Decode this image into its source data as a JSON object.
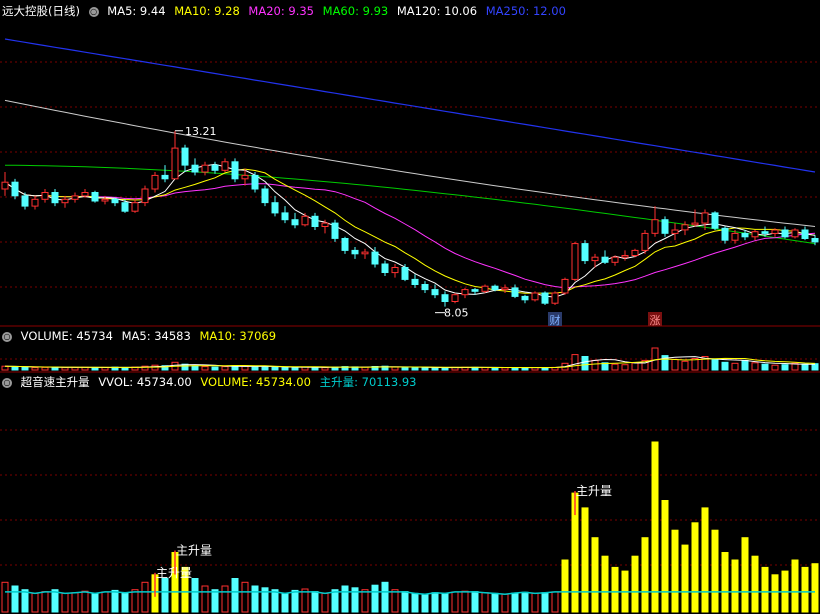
{
  "main": {
    "title": "远大控股(日线)",
    "ma_legend": [
      {
        "label": "MA5: 9.44",
        "color": "#ffffff"
      },
      {
        "label": "MA10: 9.28",
        "color": "#ffff00"
      },
      {
        "label": "MA20: 9.35",
        "color": "#ff00ff"
      },
      {
        "label": "MA60: 9.93",
        "color": "#00ff00"
      },
      {
        "label": "MA120: 10.06",
        "color": "#ffffff"
      },
      {
        "label": "MA250: 12.00",
        "color": "#3344ff"
      }
    ]
  },
  "volume_panel": {
    "legend": [
      {
        "label": "VOLUME: 45734",
        "color": "#ffffff"
      },
      {
        "label": "MA5: 34583",
        "color": "#ffffff"
      },
      {
        "label": "MA10: 37069",
        "color": "#ffff00"
      }
    ]
  },
  "indicator_panel": {
    "legend": [
      {
        "label": "超音速主升量",
        "color": "#ffffff"
      },
      {
        "label": "VVOL: 45734.00",
        "color": "#ffffff"
      },
      {
        "label": "VOLUME: 45734.00",
        "color": "#ffff00"
      },
      {
        "label": "主升量: 70113.93",
        "color": "#00cccc"
      }
    ]
  },
  "colors": {
    "up": "#ff3030",
    "down": "#54ffff",
    "ma5": "#ffffff",
    "ma10": "#ffff00",
    "ma20": "#ff33ff",
    "ma60": "#00cc00",
    "ma120": "#cccccc",
    "ma250": "#2233ee",
    "grid": "#7a0000",
    "separator": "#8b0000",
    "signal": "#ffff00"
  },
  "chart_data": [
    {
      "type": "candlestick",
      "title": "远大控股(日线)",
      "annotations": [
        {
          "text": "13.21",
          "kind": "high"
        },
        {
          "text": "8.05",
          "kind": "low"
        },
        {
          "text": "财",
          "kind": "event"
        },
        {
          "text": "涨",
          "kind": "event"
        }
      ],
      "candles": [
        [
          11.5,
          12.0,
          11.3,
          11.7
        ],
        [
          11.7,
          11.8,
          11.2,
          11.3
        ],
        [
          11.3,
          11.4,
          10.9,
          11.0
        ],
        [
          11.0,
          11.3,
          10.9,
          11.2
        ],
        [
          11.2,
          11.5,
          11.1,
          11.4
        ],
        [
          11.4,
          11.5,
          11.0,
          11.1
        ],
        [
          11.1,
          11.3,
          10.95,
          11.2
        ],
        [
          11.2,
          11.4,
          11.1,
          11.3
        ],
        [
          11.3,
          11.5,
          11.25,
          11.4
        ],
        [
          11.4,
          11.45,
          11.1,
          11.15
        ],
        [
          11.15,
          11.3,
          11.05,
          11.2
        ],
        [
          11.2,
          11.25,
          11.0,
          11.1
        ],
        [
          11.1,
          11.2,
          10.8,
          10.85
        ],
        [
          10.85,
          11.2,
          10.8,
          11.1
        ],
        [
          11.1,
          11.6,
          11.0,
          11.5
        ],
        [
          11.5,
          12.0,
          11.4,
          11.9
        ],
        [
          11.9,
          12.2,
          11.7,
          11.8
        ],
        [
          11.8,
          13.21,
          11.8,
          12.7
        ],
        [
          12.7,
          12.8,
          12.0,
          12.2
        ],
        [
          12.2,
          12.4,
          11.9,
          12.0
        ],
        [
          12.0,
          12.3,
          11.9,
          12.2
        ],
        [
          12.2,
          12.3,
          11.95,
          12.05
        ],
        [
          12.05,
          12.4,
          12.0,
          12.3
        ],
        [
          12.3,
          12.4,
          11.7,
          11.8
        ],
        [
          11.8,
          12.1,
          11.6,
          11.9
        ],
        [
          11.9,
          12.0,
          11.4,
          11.5
        ],
        [
          11.5,
          11.6,
          11.0,
          11.1
        ],
        [
          11.1,
          11.3,
          10.7,
          10.8
        ],
        [
          10.8,
          11.0,
          10.5,
          10.6
        ],
        [
          10.6,
          10.8,
          10.35,
          10.45
        ],
        [
          10.45,
          10.8,
          10.4,
          10.7
        ],
        [
          10.7,
          10.8,
          10.3,
          10.4
        ],
        [
          10.4,
          10.6,
          10.2,
          10.5
        ],
        [
          10.5,
          10.6,
          9.95,
          10.05
        ],
        [
          10.05,
          10.1,
          9.6,
          9.7
        ],
        [
          9.7,
          9.8,
          9.45,
          9.6
        ],
        [
          9.6,
          9.75,
          9.45,
          9.65
        ],
        [
          9.65,
          9.8,
          9.2,
          9.3
        ],
        [
          9.3,
          9.4,
          8.95,
          9.05
        ],
        [
          9.05,
          9.3,
          8.9,
          9.2
        ],
        [
          9.2,
          9.3,
          8.8,
          8.85
        ],
        [
          8.85,
          9.0,
          8.6,
          8.7
        ],
        [
          8.7,
          8.8,
          8.45,
          8.55
        ],
        [
          8.55,
          8.7,
          8.3,
          8.4
        ],
        [
          8.4,
          8.5,
          8.05,
          8.2
        ],
        [
          8.2,
          8.45,
          8.15,
          8.4
        ],
        [
          8.4,
          8.6,
          8.3,
          8.55
        ],
        [
          8.55,
          8.6,
          8.4,
          8.5
        ],
        [
          8.5,
          8.7,
          8.45,
          8.65
        ],
        [
          8.65,
          8.7,
          8.5,
          8.55
        ],
        [
          8.55,
          8.7,
          8.45,
          8.6
        ],
        [
          8.6,
          8.7,
          8.3,
          8.35
        ],
        [
          8.35,
          8.4,
          8.15,
          8.25
        ],
        [
          8.25,
          8.5,
          8.2,
          8.45
        ],
        [
          8.45,
          8.5,
          8.1,
          8.15
        ],
        [
          8.15,
          8.5,
          8.1,
          8.45
        ],
        [
          8.45,
          8.9,
          8.4,
          8.85
        ],
        [
          8.85,
          9.95,
          8.8,
          9.9
        ],
        [
          9.9,
          10.0,
          9.3,
          9.4
        ],
        [
          9.4,
          9.6,
          9.2,
          9.5
        ],
        [
          9.5,
          9.7,
          9.3,
          9.35
        ],
        [
          9.35,
          9.55,
          9.25,
          9.5
        ],
        [
          9.5,
          9.7,
          9.4,
          9.55
        ],
        [
          9.55,
          9.75,
          9.5,
          9.7
        ],
        [
          9.7,
          10.3,
          9.6,
          10.2
        ],
        [
          10.2,
          11.0,
          10.1,
          10.6
        ],
        [
          10.6,
          10.7,
          10.1,
          10.2
        ],
        [
          10.2,
          10.5,
          10.0,
          10.3
        ],
        [
          10.3,
          10.55,
          10.15,
          10.45
        ],
        [
          10.45,
          10.9,
          10.4,
          10.5
        ],
        [
          10.5,
          10.9,
          10.3,
          10.8
        ],
        [
          10.8,
          10.85,
          10.3,
          10.35
        ],
        [
          10.35,
          10.4,
          9.9,
          10.0
        ],
        [
          10.0,
          10.3,
          9.9,
          10.2
        ],
        [
          10.2,
          10.3,
          10.0,
          10.1
        ],
        [
          10.1,
          10.3,
          10.0,
          10.25
        ],
        [
          10.25,
          10.4,
          10.1,
          10.2
        ],
        [
          10.2,
          10.35,
          10.1,
          10.3
        ],
        [
          10.3,
          10.4,
          10.05,
          10.1
        ],
        [
          10.1,
          10.35,
          10.05,
          10.3
        ],
        [
          10.3,
          10.4,
          10.0,
          10.05
        ],
        [
          10.05,
          10.15,
          9.85,
          9.95
        ]
      ],
      "volume": [
        8000,
        7000,
        6000,
        5000,
        5500,
        6000,
        5000,
        5200,
        5600,
        5000,
        5400,
        5800,
        5200,
        6000,
        8000,
        10000,
        9000,
        16000,
        12000,
        9000,
        7000,
        6000,
        7000,
        9000,
        8000,
        7000,
        6500,
        6000,
        5000,
        5800,
        6200,
        5500,
        5000,
        6000,
        7000,
        6500,
        6000,
        7200,
        8000,
        6000,
        5500,
        5000,
        4800,
        5200,
        5000,
        5400,
        5600,
        5500,
        5200,
        5000,
        4800,
        5100,
        5300,
        5000,
        5200,
        5400,
        14000,
        32000,
        28000,
        20000,
        15000,
        12000,
        11000,
        15000,
        20000,
        45734,
        30000,
        22000,
        18000,
        24000,
        28000,
        22000,
        16000,
        14000,
        20000,
        15000,
        12000,
        10000,
        11000,
        14000,
        12000,
        13000
      ],
      "volume_ma": {
        "ma5": 34583,
        "ma10": 37069
      },
      "signals": [
        {
          "index": 15,
          "label": "主升量"
        },
        {
          "index": 17,
          "label": "主升量"
        },
        {
          "index": 57,
          "label": "主升量"
        }
      ],
      "ylim": [
        7.6,
        16.4
      ],
      "current_ma": {
        "MA5": 9.44,
        "MA10": 9.28,
        "MA20": 9.35,
        "MA60": 9.93,
        "MA120": 10.06,
        "MA250": 12.0
      }
    }
  ]
}
